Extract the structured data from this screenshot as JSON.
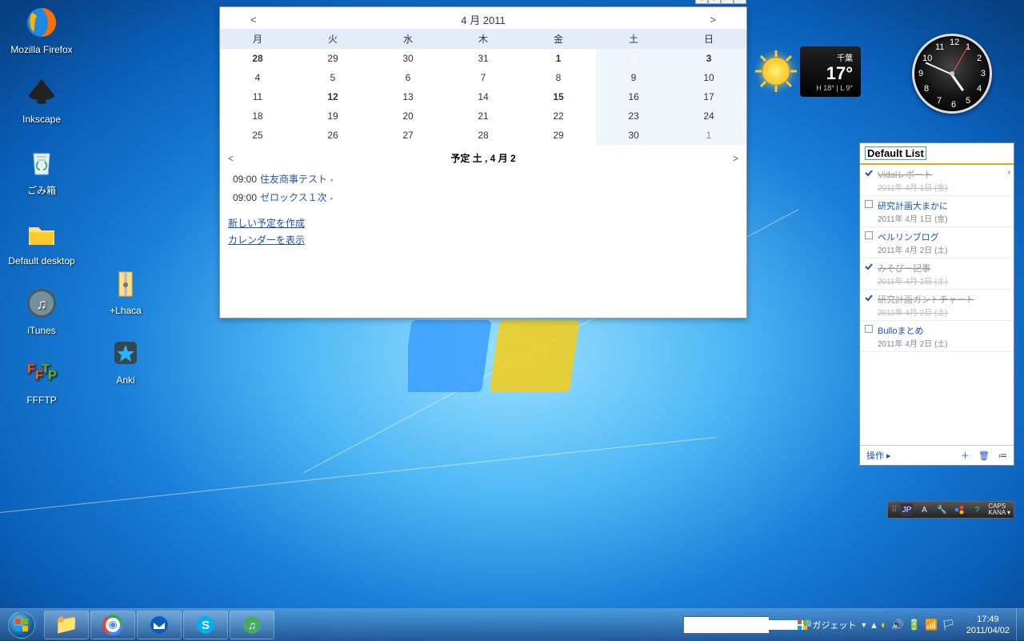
{
  "desktop_icons": {
    "col1": [
      {
        "label": "Mozilla Firefox",
        "icon": "firefox"
      },
      {
        "label": "Inkscape",
        "icon": "inkscape"
      },
      {
        "label": "ごみ箱",
        "icon": "recycle"
      },
      {
        "label": "Default desktop",
        "icon": "folder"
      },
      {
        "label": "iTunes",
        "icon": "itunes"
      },
      {
        "label": "FFFTP",
        "icon": "ffftp"
      }
    ],
    "col2": [
      {
        "label": "+Lhaca",
        "icon": "lhaca"
      },
      {
        "label": "Anki",
        "icon": "anki"
      }
    ]
  },
  "calendar": {
    "prev": "<",
    "next": ">",
    "title": "4 月 2011",
    "dow": [
      "月",
      "火",
      "水",
      "木",
      "金",
      "土",
      "日"
    ],
    "rows": [
      [
        {
          "d": "28",
          "cls": "bold"
        },
        {
          "d": "29"
        },
        {
          "d": "30"
        },
        {
          "d": "31"
        },
        {
          "d": "1",
          "cls": "bold"
        },
        {
          "d": "2",
          "cls": "selected wk"
        },
        {
          "d": "3",
          "cls": "bold wk"
        }
      ],
      [
        {
          "d": "4"
        },
        {
          "d": "5"
        },
        {
          "d": "6"
        },
        {
          "d": "7"
        },
        {
          "d": "8"
        },
        {
          "d": "9",
          "cls": "wk"
        },
        {
          "d": "10",
          "cls": "wk"
        }
      ],
      [
        {
          "d": "11"
        },
        {
          "d": "12",
          "cls": "bold"
        },
        {
          "d": "13"
        },
        {
          "d": "14"
        },
        {
          "d": "15",
          "cls": "bold"
        },
        {
          "d": "16",
          "cls": "wk"
        },
        {
          "d": "17",
          "cls": "wk"
        }
      ],
      [
        {
          "d": "18"
        },
        {
          "d": "19"
        },
        {
          "d": "20"
        },
        {
          "d": "21"
        },
        {
          "d": "22"
        },
        {
          "d": "23",
          "cls": "wk"
        },
        {
          "d": "24",
          "cls": "wk"
        }
      ],
      [
        {
          "d": "25"
        },
        {
          "d": "26"
        },
        {
          "d": "27"
        },
        {
          "d": "28"
        },
        {
          "d": "29"
        },
        {
          "d": "30",
          "cls": "wk"
        },
        {
          "d": "1",
          "cls": "other wk"
        }
      ]
    ],
    "agenda_title": "予定 土 , 4 月 2",
    "agenda_prev": "<",
    "agenda_next": ">",
    "events": [
      {
        "time": "09:00",
        "title": "住友商事テスト"
      },
      {
        "time": "09:00",
        "title": "ゼロックス１次"
      }
    ],
    "link_new": "新しい予定を作成",
    "link_show": "カレンダーを表示"
  },
  "weather": {
    "location": "千葉",
    "temp": "17°",
    "high": "H 18°",
    "sep": " | ",
    "low": "L 9°"
  },
  "clock_numbers": {
    "n12": "12",
    "n3": "3",
    "n6": "6",
    "n9": "9",
    "n1": "1",
    "n2": "2",
    "n4": "4",
    "n5": "5",
    "n7": "7",
    "n8": "8",
    "n10": "10",
    "n11": "11"
  },
  "todo": {
    "header": "Default List",
    "items": [
      {
        "title": "Vidalレポート",
        "date": "2011年 4月 1日 (金)",
        "done": true,
        "arrow": true
      },
      {
        "title": "研究計画大まかに",
        "date": "2011年 4月 1日 (金)",
        "done": false
      },
      {
        "title": "ベルリンブログ",
        "date": "2011年 4月 2日 (土)",
        "done": false
      },
      {
        "title": "みそぴー記事",
        "date": "2011年 4月 2日 (土)",
        "done": true
      },
      {
        "title": "研究計画ガントチャート",
        "date": "2011年 4月 2日 (土)",
        "done": true
      },
      {
        "title": "Bulloまとめ",
        "date": "2011年 4月 2日 (土)",
        "done": false
      }
    ],
    "footer_action": "操作 ▸"
  },
  "ime": {
    "lang": "JP",
    "mode": "A",
    "caps": "CAPS",
    "kana": "KANA"
  },
  "taskbar": {
    "gadget_label": "ガジェット",
    "time": "17:49",
    "date": "2011/04/02",
    "search_placeholder": ""
  }
}
